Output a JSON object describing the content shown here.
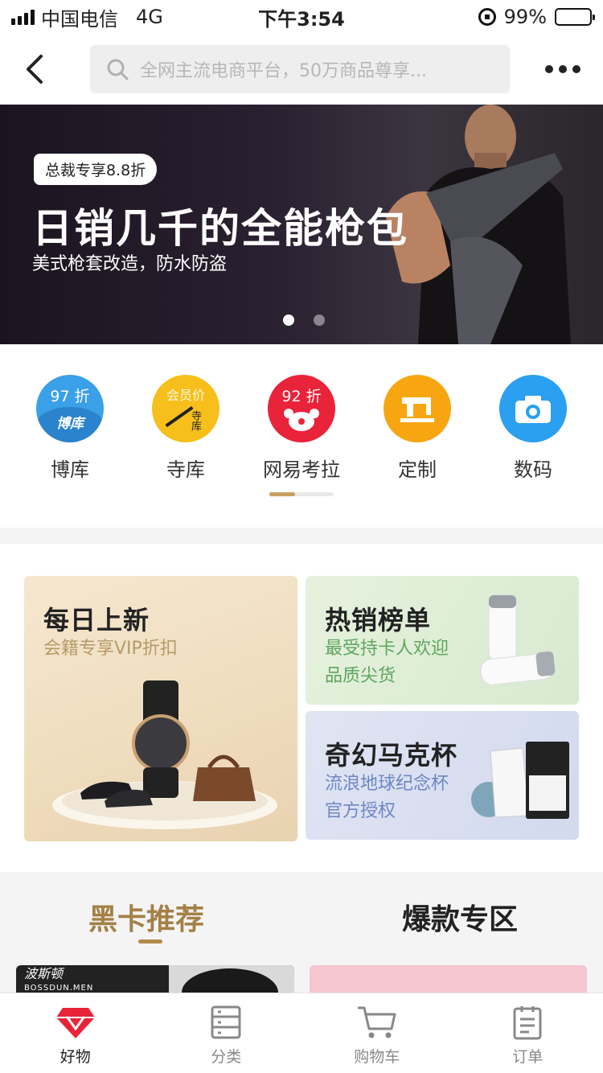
{
  "status_bar": {
    "carrier": "中国电信",
    "network": "4G",
    "time": "下午3:54",
    "battery_text": "99%",
    "battery_level": 0.99
  },
  "nav": {
    "search_placeholder": "全网主流电商平台，50万商品尊享..."
  },
  "banner": {
    "tag": "总裁专享8.8折",
    "title": "日销几千的全能枪包",
    "subtitle": "美式枪套改造，防水防盗",
    "page_count": 2,
    "active_page": 1
  },
  "categories": {
    "items": [
      {
        "label": "博库",
        "badge": "97 折",
        "icon_text": "博库",
        "icon": "bookstore-icon",
        "color": "#3aa0e8"
      },
      {
        "label": "寺库",
        "badge": "会员价",
        "icon_text": "寺库",
        "icon": "secoo-icon",
        "color": "#f6bf1b"
      },
      {
        "label": "网易考拉",
        "badge": "92 折",
        "icon_text": "",
        "icon": "koala-icon",
        "color": "#e8233a"
      },
      {
        "label": "定制",
        "badge": "",
        "icon_text": "",
        "icon": "sewing-machine-icon",
        "color": "#f7a611"
      },
      {
        "label": "数码",
        "badge": "",
        "icon_text": "",
        "icon": "camera-icon",
        "color": "#2b9ff0"
      }
    ],
    "scroll_progress": 0.4
  },
  "promos": {
    "daily_new": {
      "title": "每日上新",
      "subtitle": "会籍专享VIP折扣"
    },
    "hot_list": {
      "title": "热销榜单",
      "line1": "最受持卡人欢迎",
      "line2": "品质尖货"
    },
    "mug": {
      "title": "奇幻马克杯",
      "line1": "流浪地球纪念杯",
      "line2": "官方授权"
    }
  },
  "section_tabs": {
    "active": "黑卡推荐",
    "other": "爆款专区"
  },
  "products": {
    "left_brand": "波斯顿",
    "left_brand_en": "BOSSDUN.MEN"
  },
  "tabbar": {
    "items": [
      {
        "label": "好物",
        "icon": "diamond-icon",
        "active": true
      },
      {
        "label": "分类",
        "icon": "category-icon",
        "active": false
      },
      {
        "label": "购物车",
        "icon": "cart-icon",
        "active": false
      },
      {
        "label": "订单",
        "icon": "order-icon",
        "active": false
      }
    ]
  },
  "colors": {
    "accent_gold": "#a48046",
    "active_red": "#e8233a"
  }
}
